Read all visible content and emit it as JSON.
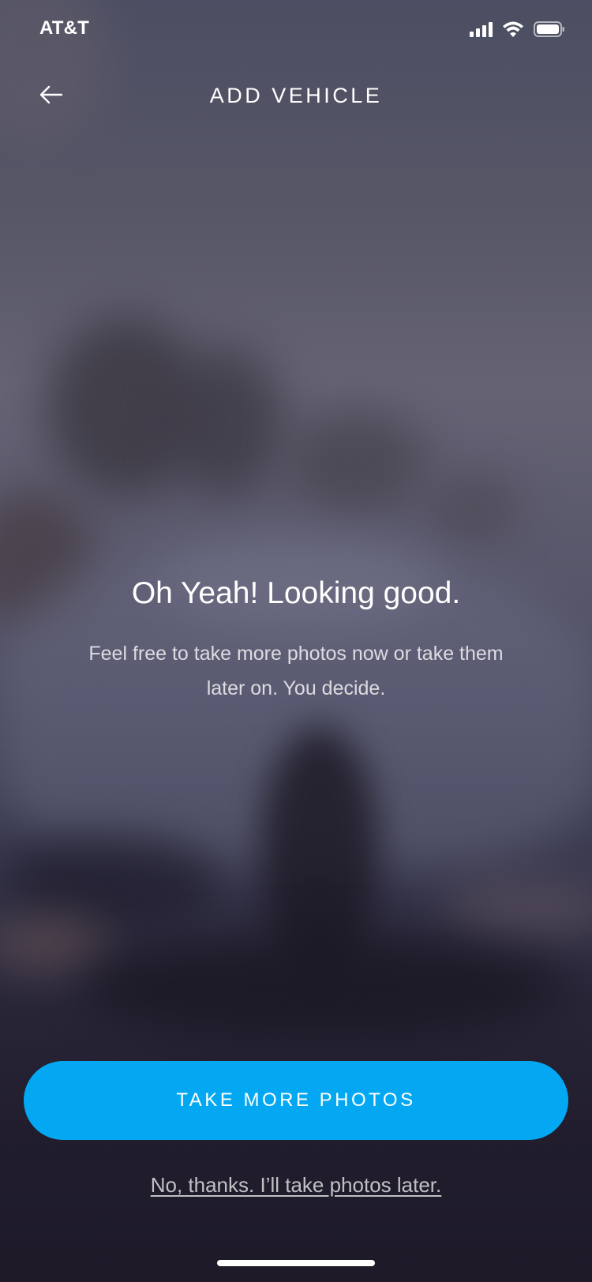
{
  "status_bar": {
    "carrier": "AT&T",
    "icons": [
      "signal-icon",
      "wifi-icon",
      "battery-icon"
    ]
  },
  "header": {
    "title": "ADD VEHICLE",
    "back_icon": "back-arrow-icon"
  },
  "main": {
    "headline": "Oh Yeah! Looking good.",
    "subtext": "Feel free to take more photos now or take them later on. You decide."
  },
  "actions": {
    "primary_label": "TAKE MORE PHOTOS",
    "secondary_label": "No, thanks. I’ll take photos later."
  },
  "colors": {
    "accent": "#04a8f2",
    "text": "#ffffff"
  }
}
